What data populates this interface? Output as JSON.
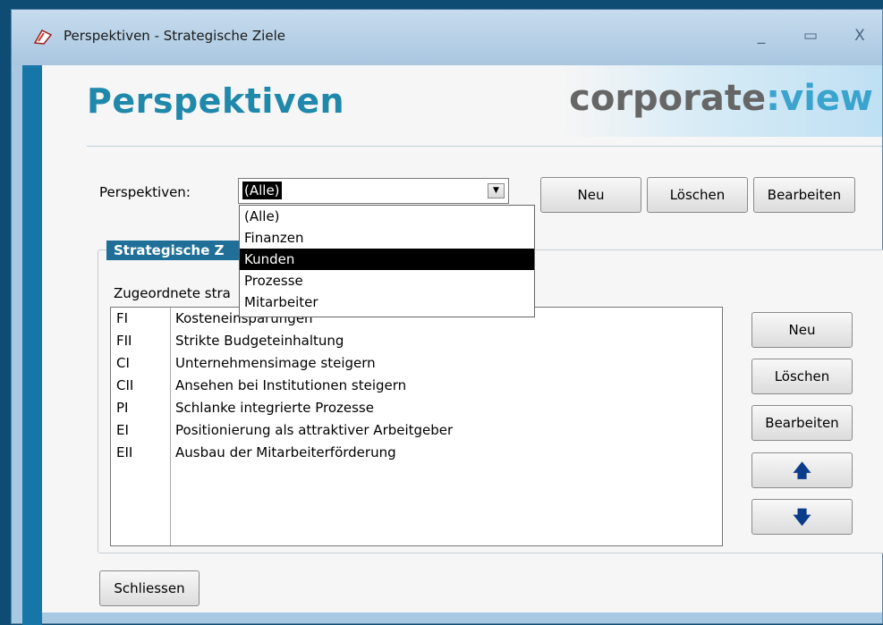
{
  "window": {
    "title": "Perspektiven - Strategische Ziele",
    "controls": {
      "minimize": "_",
      "maximize": "▭",
      "close": "X"
    }
  },
  "header": {
    "title": "Perspektiven",
    "logo_part1": "corporate",
    "logo_sep": ":",
    "logo_part2": "view"
  },
  "filter": {
    "label": "Perspektiven:",
    "selected": "(Alle)",
    "options": [
      "(Alle)",
      "Finanzen",
      "Kunden",
      "Prozesse",
      "Mitarbeiter"
    ],
    "highlighted_option": "Kunden"
  },
  "top_buttons": {
    "neu": "Neu",
    "loeschen": "Löschen",
    "bearbeiten": "Bearbeiten"
  },
  "group": {
    "title": "Strategische Z",
    "list_label": "Zugeordnete stra"
  },
  "goals": [
    {
      "code": "FI",
      "name": "Kosteneinsparungen"
    },
    {
      "code": "FII",
      "name": "Strikte Budgeteinhaltung"
    },
    {
      "code": "CI",
      "name": "Unternehmensimage steigern"
    },
    {
      "code": "CII",
      "name": "Ansehen bei Institutionen steigern"
    },
    {
      "code": "PI",
      "name": "Schlanke integrierte Prozesse"
    },
    {
      "code": "EI",
      "name": "Positionierung als attraktiver Arbeitgeber"
    },
    {
      "code": "EII",
      "name": "Ausbau der Mitarbeiterförderung"
    }
  ],
  "side_buttons": {
    "neu": "Neu",
    "loeschen": "Löschen",
    "bearbeiten": "Bearbeiten",
    "up": "🡅",
    "down": "🡇"
  },
  "footer": {
    "close": "Schliessen"
  }
}
